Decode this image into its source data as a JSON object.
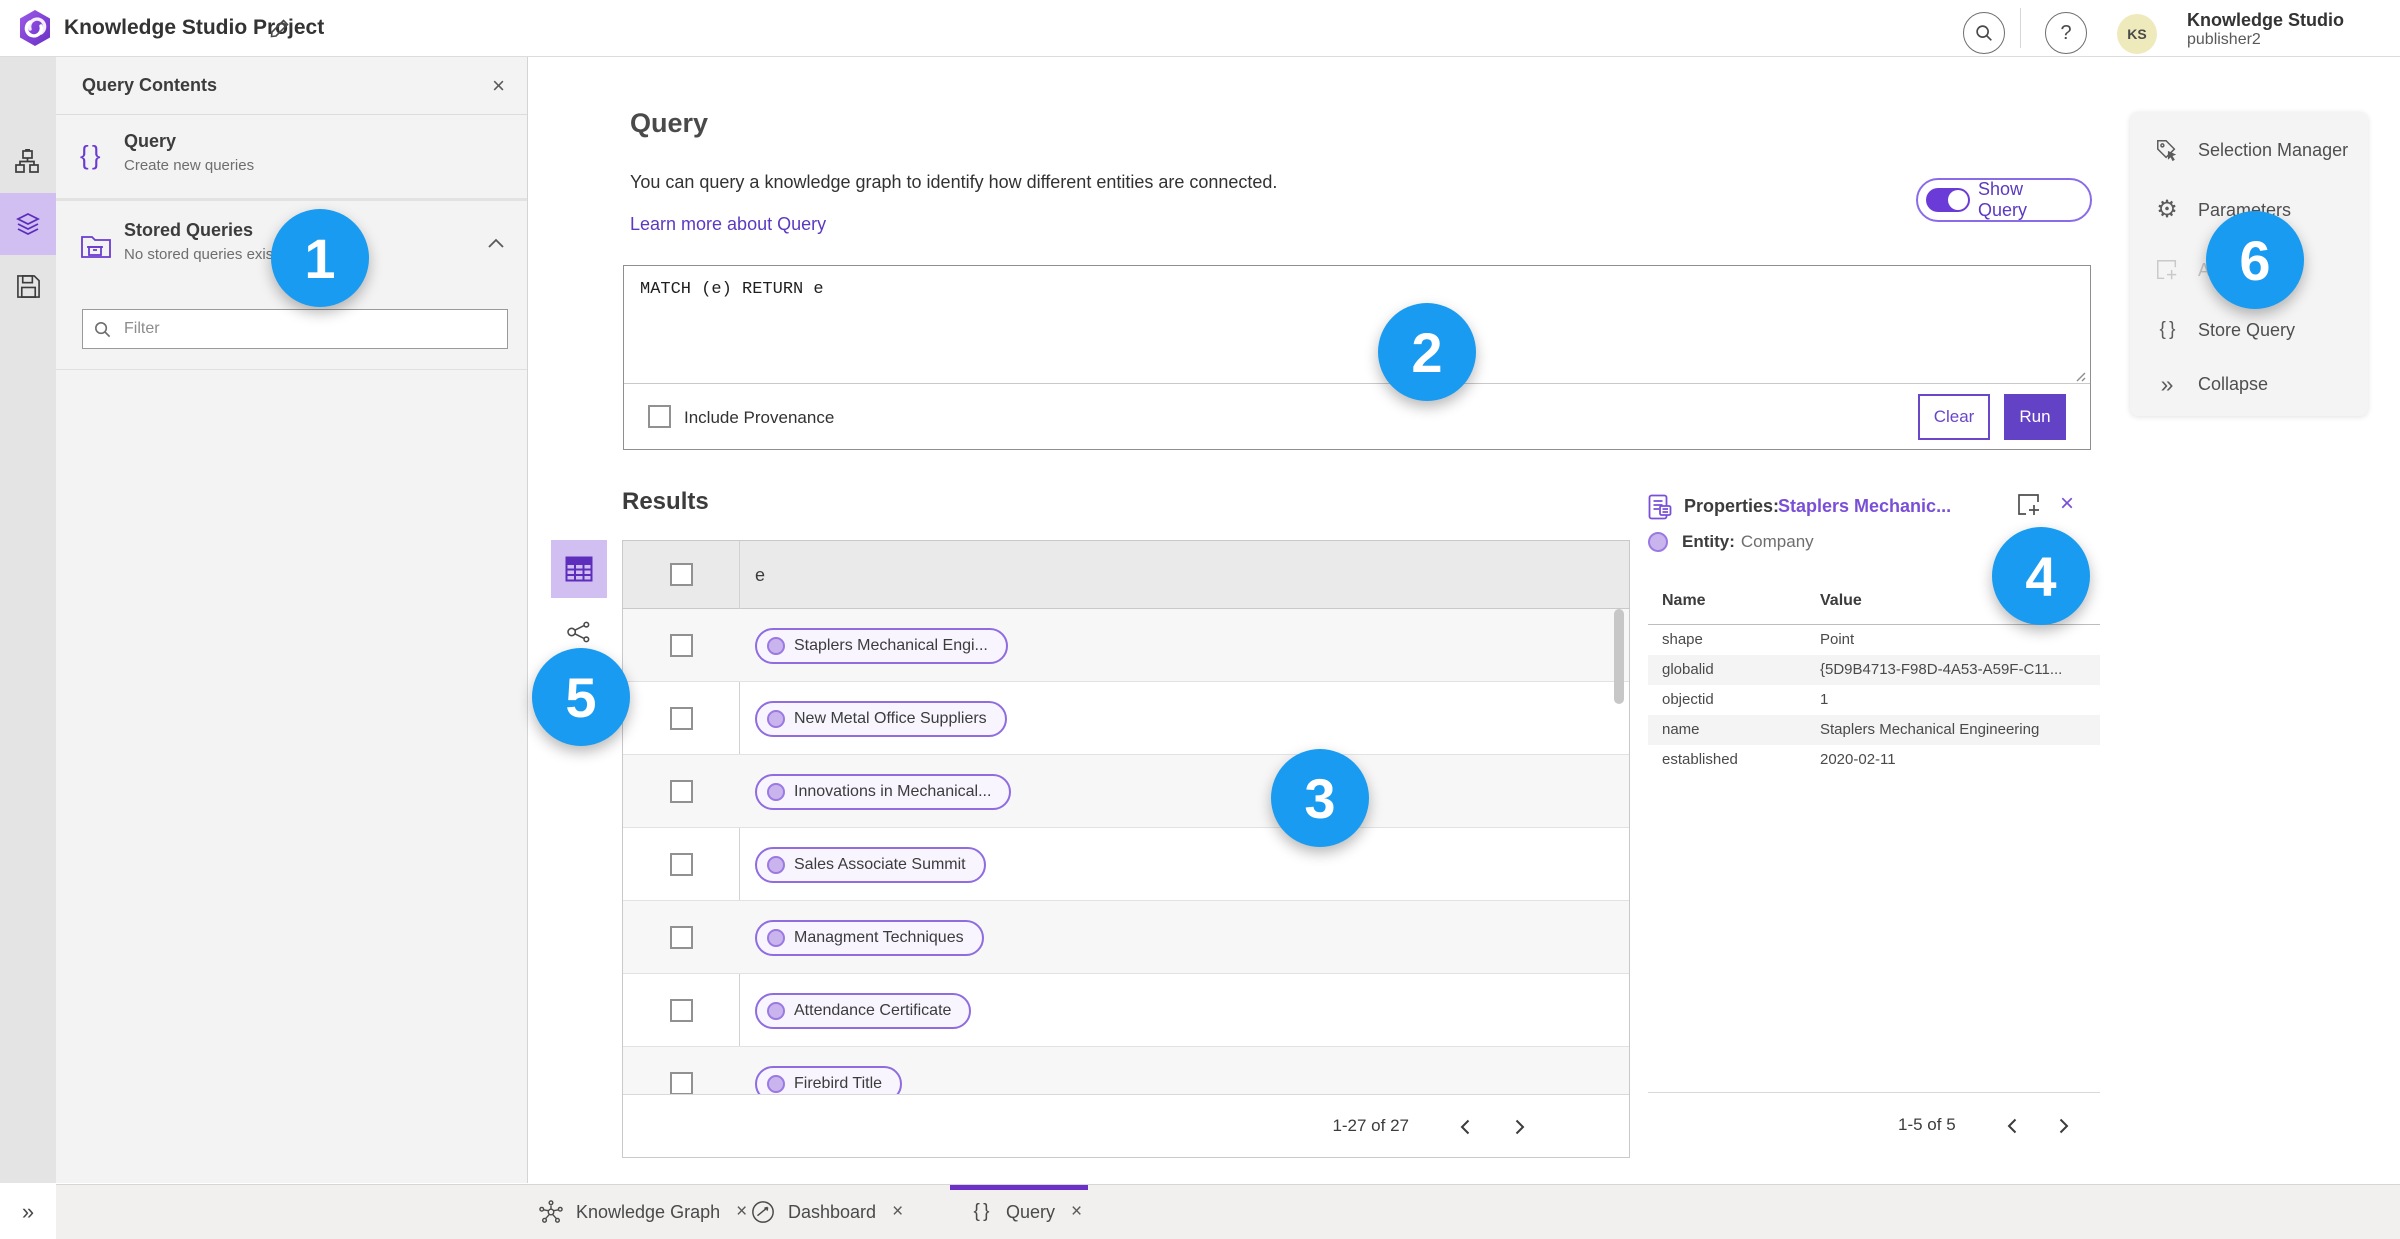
{
  "topbar": {
    "title": "Knowledge Studio Project",
    "user_name": "Knowledge Studio",
    "user_role": "publisher2",
    "avatar_initials": "KS"
  },
  "icons": {
    "help": "?",
    "close": "×",
    "braces": "{ }",
    "gear": "⚙",
    "double_chevron_right": "»"
  },
  "sidebar": {
    "panel_title": "Query Contents",
    "items": [
      {
        "title": "Query",
        "subtitle": "Create new queries"
      },
      {
        "title": "Stored Queries",
        "subtitle": "No stored queries exist"
      }
    ],
    "filter_placeholder": "Filter"
  },
  "query_section": {
    "title": "Query",
    "description": "You can query a knowledge graph to identify how different entities are connected.",
    "learn_more": "Learn more about Query",
    "show_query_label": "Show Query",
    "show_query_on": true,
    "query_text": "MATCH (e) RETURN e",
    "include_provenance_label": "Include Provenance",
    "clear_label": "Clear",
    "run_label": "Run"
  },
  "results": {
    "title": "Results",
    "column_header": "e",
    "rows": [
      "Staplers Mechanical Engi...",
      "New Metal Office Suppliers",
      "Innovations in Mechanical...",
      "Sales Associate Summit",
      "Managment Techniques",
      "Attendance Certificate",
      "Firebird Title"
    ],
    "pagination": "1-27 of 27"
  },
  "properties_panel": {
    "title": "Properties:",
    "entity_link": "Staplers Mechanic...",
    "entity_label": "Entity:",
    "entity_type": "Company",
    "columns": [
      "Name",
      "Value"
    ],
    "rows": [
      {
        "name": "shape",
        "value": "Point"
      },
      {
        "name": "globalid",
        "value": "{5D9B4713-F98D-4A53-A59F-C11..."
      },
      {
        "name": "objectid",
        "value": "1"
      },
      {
        "name": "name",
        "value": "Staplers Mechanical Engineering"
      },
      {
        "name": "established",
        "value": "2020-02-11"
      }
    ],
    "pagination": "1-5 of 5"
  },
  "tools_menu": {
    "items": [
      "Selection Manager",
      "Parameters",
      "Add",
      "Store Query",
      "Collapse"
    ]
  },
  "bottom_tabs": [
    {
      "label": "Knowledge Graph"
    },
    {
      "label": "Dashboard"
    },
    {
      "label": "Query"
    }
  ],
  "annotations": {
    "numbers": [
      "1",
      "2",
      "3",
      "4",
      "5",
      "6"
    ]
  },
  "colors": {
    "accent_purple": "#6a43c8",
    "selected_purple_bg": "#d2bff1",
    "chip_border_purple": "#8f6ce0",
    "link_purple": "#5b39c0",
    "annotation_blue": "#189bf0",
    "avatar_yellow": "#efeabc"
  }
}
